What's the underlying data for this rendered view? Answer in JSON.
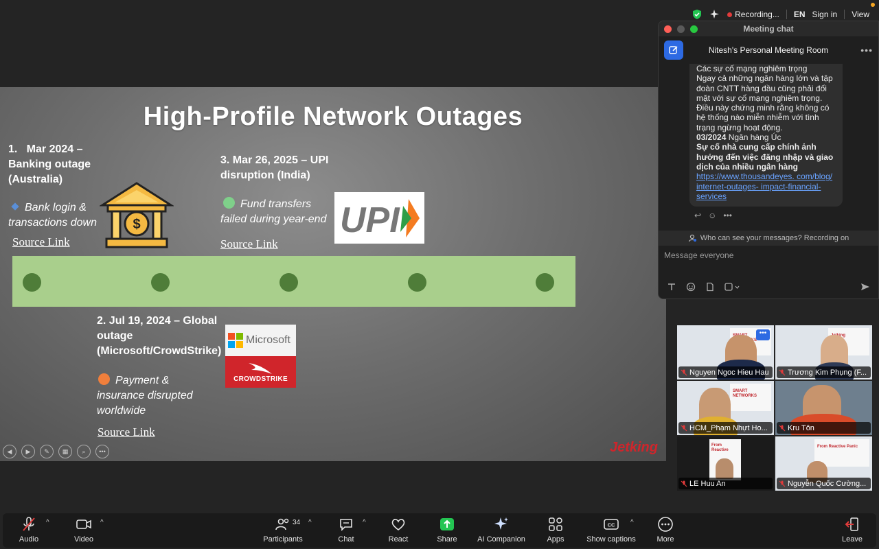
{
  "top_bar": {
    "recording": "Recording...",
    "language": "EN",
    "sign_in": "Sign in",
    "view": "View"
  },
  "slide": {
    "title": "High-Profile Network Outages",
    "events": [
      {
        "title": "1.   Mar 2024 –\nBanking outage\n(Australia)",
        "desc": "Bank login &\ntransactions down",
        "link": "Source Link"
      },
      {
        "title": "2. Jul 19, 2024 – Global\noutage\n(Microsoft/CrowdStrike)",
        "desc": "Payment &\ninsurance disrupted\nworldwide",
        "link": "Source Link"
      },
      {
        "title": "3. Mar 26, 2025 – UPI\ndisruption (India)",
        "desc": "Fund transfers\nfailed during year-end",
        "link": "Source Link"
      }
    ],
    "logos": {
      "upi": "UPI",
      "microsoft": "Microsoft",
      "crowdstrike": "CROWDSTRIKE",
      "jetking": "Jetking"
    }
  },
  "chat": {
    "window_title": "Meeting chat",
    "room": "Nitesh's Personal Meeting Room",
    "message": {
      "line1": "Các sự cố mạng nghiêm trọng",
      "line2": "Ngay cả những ngân hàng lớn và tập đoàn CNTT hàng đầu cũng phải đối mặt với sự cố mạng nghiêm trọng. Điều này chứng minh rằng không có hệ thống nào miễn nhiễm với tình trạng ngừng hoạt động.",
      "date_bold": "03/2024",
      "date_rest": " Ngân hàng Úc",
      "bold_line": "Sự cố nhà cung cấp chính ảnh hưởng đến việc đăng nhập và giao dịch của nhiều ngân hàng",
      "link": "https://www.thousandeyes. com/blog/ internet-outages- impact-financial- services"
    },
    "who_can_see": "Who can see your messages? Recording on",
    "input_placeholder": "Message everyone"
  },
  "participants": [
    {
      "name": "Nguyen Ngoc Hieu Hau"
    },
    {
      "name": "Trương Kim Phụng (F..."
    },
    {
      "name": "HCM_Phạm Nhựt Ho..."
    },
    {
      "name": "Kru Tôn"
    },
    {
      "name": "LE Huu An"
    },
    {
      "name": "Nguyễn Quốc Cường..."
    }
  ],
  "toolbar": {
    "audio": "Audio",
    "video": "Video",
    "participants": "Participants",
    "participant_count": "34",
    "chat": "Chat",
    "react": "React",
    "share": "Share",
    "ai_companion": "AI Companion",
    "apps": "Apps",
    "show_captions": "Show captions",
    "more": "More",
    "leave": "Leave"
  },
  "colors": {
    "share_green": "#23c552",
    "compose_blue": "#2d6ae3",
    "timeline_green": "#a9cf8c",
    "timeline_dot": "#4f7d39",
    "jetking_red": "#d0252b"
  }
}
